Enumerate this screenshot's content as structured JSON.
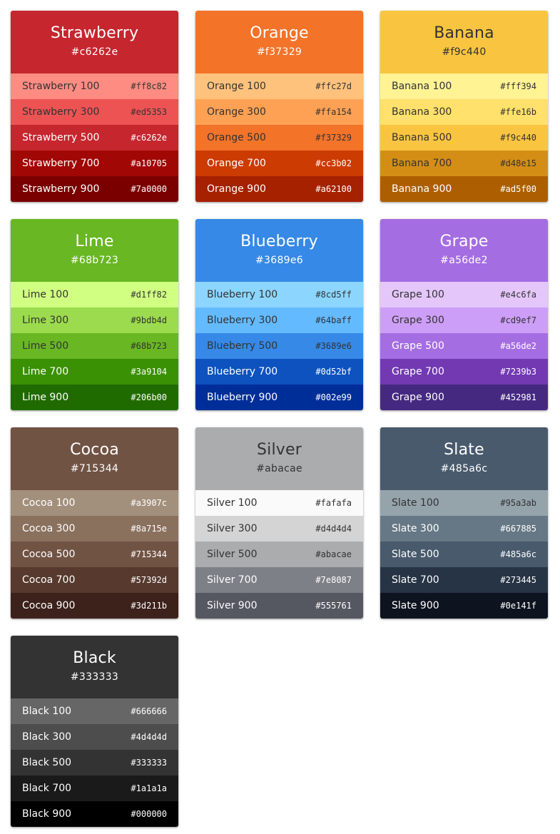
{
  "palettes": [
    {
      "name": "Strawberry",
      "hex": "#c6262e",
      "header_text": "#ffffff",
      "shades": [
        {
          "label": "Strawberry 100",
          "hex": "#ff8c82",
          "text": "#333333"
        },
        {
          "label": "Strawberry 300",
          "hex": "#ed5353",
          "text": "#333333"
        },
        {
          "label": "Strawberry 500",
          "hex": "#c6262e",
          "text": "#ffffff"
        },
        {
          "label": "Strawberry 700",
          "hex": "#a10705",
          "text": "#ffffff"
        },
        {
          "label": "Strawberry 900",
          "hex": "#7a0000",
          "text": "#ffffff"
        }
      ]
    },
    {
      "name": "Orange",
      "hex": "#f37329",
      "header_text": "#ffffff",
      "shades": [
        {
          "label": "Orange 100",
          "hex": "#ffc27d",
          "text": "#333333"
        },
        {
          "label": "Orange 300",
          "hex": "#ffa154",
          "text": "#333333"
        },
        {
          "label": "Orange 500",
          "hex": "#f37329",
          "text": "#333333"
        },
        {
          "label": "Orange 700",
          "hex": "#cc3b02",
          "text": "#ffffff"
        },
        {
          "label": "Orange 900",
          "hex": "#a62100",
          "text": "#ffffff"
        }
      ]
    },
    {
      "name": "Banana",
      "hex": "#f9c440",
      "header_text": "#333333",
      "shades": [
        {
          "label": "Banana 100",
          "hex": "#fff394",
          "text": "#333333"
        },
        {
          "label": "Banana 300",
          "hex": "#ffe16b",
          "text": "#333333"
        },
        {
          "label": "Banana 500",
          "hex": "#f9c440",
          "text": "#333333"
        },
        {
          "label": "Banana 700",
          "hex": "#d48e15",
          "text": "#333333"
        },
        {
          "label": "Banana 900",
          "hex": "#ad5f00",
          "text": "#ffffff"
        }
      ]
    },
    {
      "name": "Lime",
      "hex": "#68b723",
      "header_text": "#ffffff",
      "shades": [
        {
          "label": "Lime 100",
          "hex": "#d1ff82",
          "text": "#333333"
        },
        {
          "label": "Lime 300",
          "hex": "#9bdb4d",
          "text": "#333333"
        },
        {
          "label": "Lime 500",
          "hex": "#68b723",
          "text": "#333333"
        },
        {
          "label": "Lime 700",
          "hex": "#3a9104",
          "text": "#ffffff"
        },
        {
          "label": "Lime 900",
          "hex": "#206b00",
          "text": "#ffffff"
        }
      ]
    },
    {
      "name": "Blueberry",
      "hex": "#3689e6",
      "header_text": "#ffffff",
      "shades": [
        {
          "label": "Blueberry 100",
          "hex": "#8cd5ff",
          "text": "#333333"
        },
        {
          "label": "Blueberry 300",
          "hex": "#64baff",
          "text": "#333333"
        },
        {
          "label": "Blueberry 500",
          "hex": "#3689e6",
          "text": "#333333"
        },
        {
          "label": "Blueberry 700",
          "hex": "#0d52bf",
          "text": "#ffffff"
        },
        {
          "label": "Blueberry 900",
          "hex": "#002e99",
          "text": "#ffffff"
        }
      ]
    },
    {
      "name": "Grape",
      "hex": "#a56de2",
      "header_text": "#ffffff",
      "shades": [
        {
          "label": "Grape 100",
          "hex": "#e4c6fa",
          "text": "#333333"
        },
        {
          "label": "Grape 300",
          "hex": "#cd9ef7",
          "text": "#333333"
        },
        {
          "label": "Grape 500",
          "hex": "#a56de2",
          "text": "#ffffff"
        },
        {
          "label": "Grape 700",
          "hex": "#7239b3",
          "text": "#ffffff"
        },
        {
          "label": "Grape 900",
          "hex": "#452981",
          "text": "#ffffff"
        }
      ]
    },
    {
      "name": "Cocoa",
      "hex": "#715344",
      "header_text": "#ffffff",
      "shades": [
        {
          "label": "Cocoa 100",
          "hex": "#a3907c",
          "text": "#ffffff"
        },
        {
          "label": "Cocoa 300",
          "hex": "#8a715e",
          "text": "#ffffff"
        },
        {
          "label": "Cocoa 500",
          "hex": "#715344",
          "text": "#ffffff"
        },
        {
          "label": "Cocoa 700",
          "hex": "#57392d",
          "text": "#ffffff"
        },
        {
          "label": "Cocoa 900",
          "hex": "#3d211b",
          "text": "#ffffff"
        }
      ]
    },
    {
      "name": "Silver",
      "hex": "#abacae",
      "header_text": "#333333",
      "shades": [
        {
          "label": "Silver 100",
          "hex": "#fafafa",
          "text": "#333333"
        },
        {
          "label": "Silver 300",
          "hex": "#d4d4d4",
          "text": "#333333"
        },
        {
          "label": "Silver 500",
          "hex": "#abacae",
          "text": "#333333"
        },
        {
          "label": "Silver 700",
          "hex": "#7e8087",
          "text": "#ffffff"
        },
        {
          "label": "Silver 900",
          "hex": "#555761",
          "text": "#ffffff"
        }
      ]
    },
    {
      "name": "Slate",
      "hex": "#485a6c",
      "header_text": "#ffffff",
      "shades": [
        {
          "label": "Slate 100",
          "hex": "#95a3ab",
          "text": "#333333"
        },
        {
          "label": "Slate 300",
          "hex": "#667885",
          "text": "#ffffff"
        },
        {
          "label": "Slate 500",
          "hex": "#485a6c",
          "text": "#ffffff"
        },
        {
          "label": "Slate 700",
          "hex": "#273445",
          "text": "#ffffff"
        },
        {
          "label": "Slate 900",
          "hex": "#0e141f",
          "text": "#ffffff"
        }
      ]
    },
    {
      "name": "Black",
      "hex": "#333333",
      "header_text": "#ffffff",
      "shades": [
        {
          "label": "Black 100",
          "hex": "#666666",
          "text": "#ffffff"
        },
        {
          "label": "Black 300",
          "hex": "#4d4d4d",
          "text": "#ffffff"
        },
        {
          "label": "Black 500",
          "hex": "#333333",
          "text": "#ffffff"
        },
        {
          "label": "Black 700",
          "hex": "#1a1a1a",
          "text": "#ffffff"
        },
        {
          "label": "Black 900",
          "hex": "#000000",
          "text": "#ffffff"
        }
      ]
    }
  ]
}
